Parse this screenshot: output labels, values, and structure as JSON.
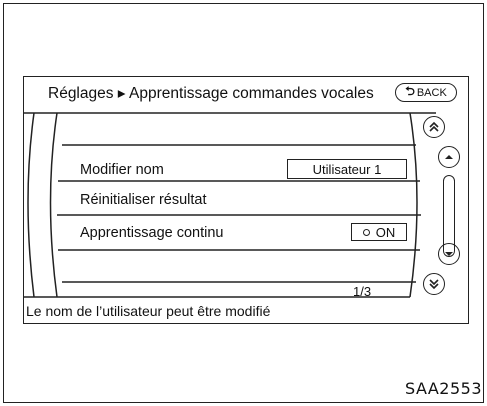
{
  "header": {
    "title": "Réglages ▸ Apprentissage commandes vocales",
    "back_label": "BACK"
  },
  "menu": {
    "items": [
      {
        "label": "Modifier nom",
        "value": "Utilisateur 1"
      },
      {
        "label": "Réinitialiser résultat"
      },
      {
        "label": "Apprentissage continu",
        "toggle": "ON"
      }
    ]
  },
  "page_indicator": "1/3",
  "status_text": "Le nom de l’utilisateur peut être modifié",
  "figure_code": "SAA2553",
  "icons": {
    "back": "back-arrow-icon",
    "page_up": "double-chevron-up-icon",
    "line_up": "chevron-up-icon",
    "line_down": "chevron-down-icon",
    "page_down": "double-chevron-down-icon"
  }
}
